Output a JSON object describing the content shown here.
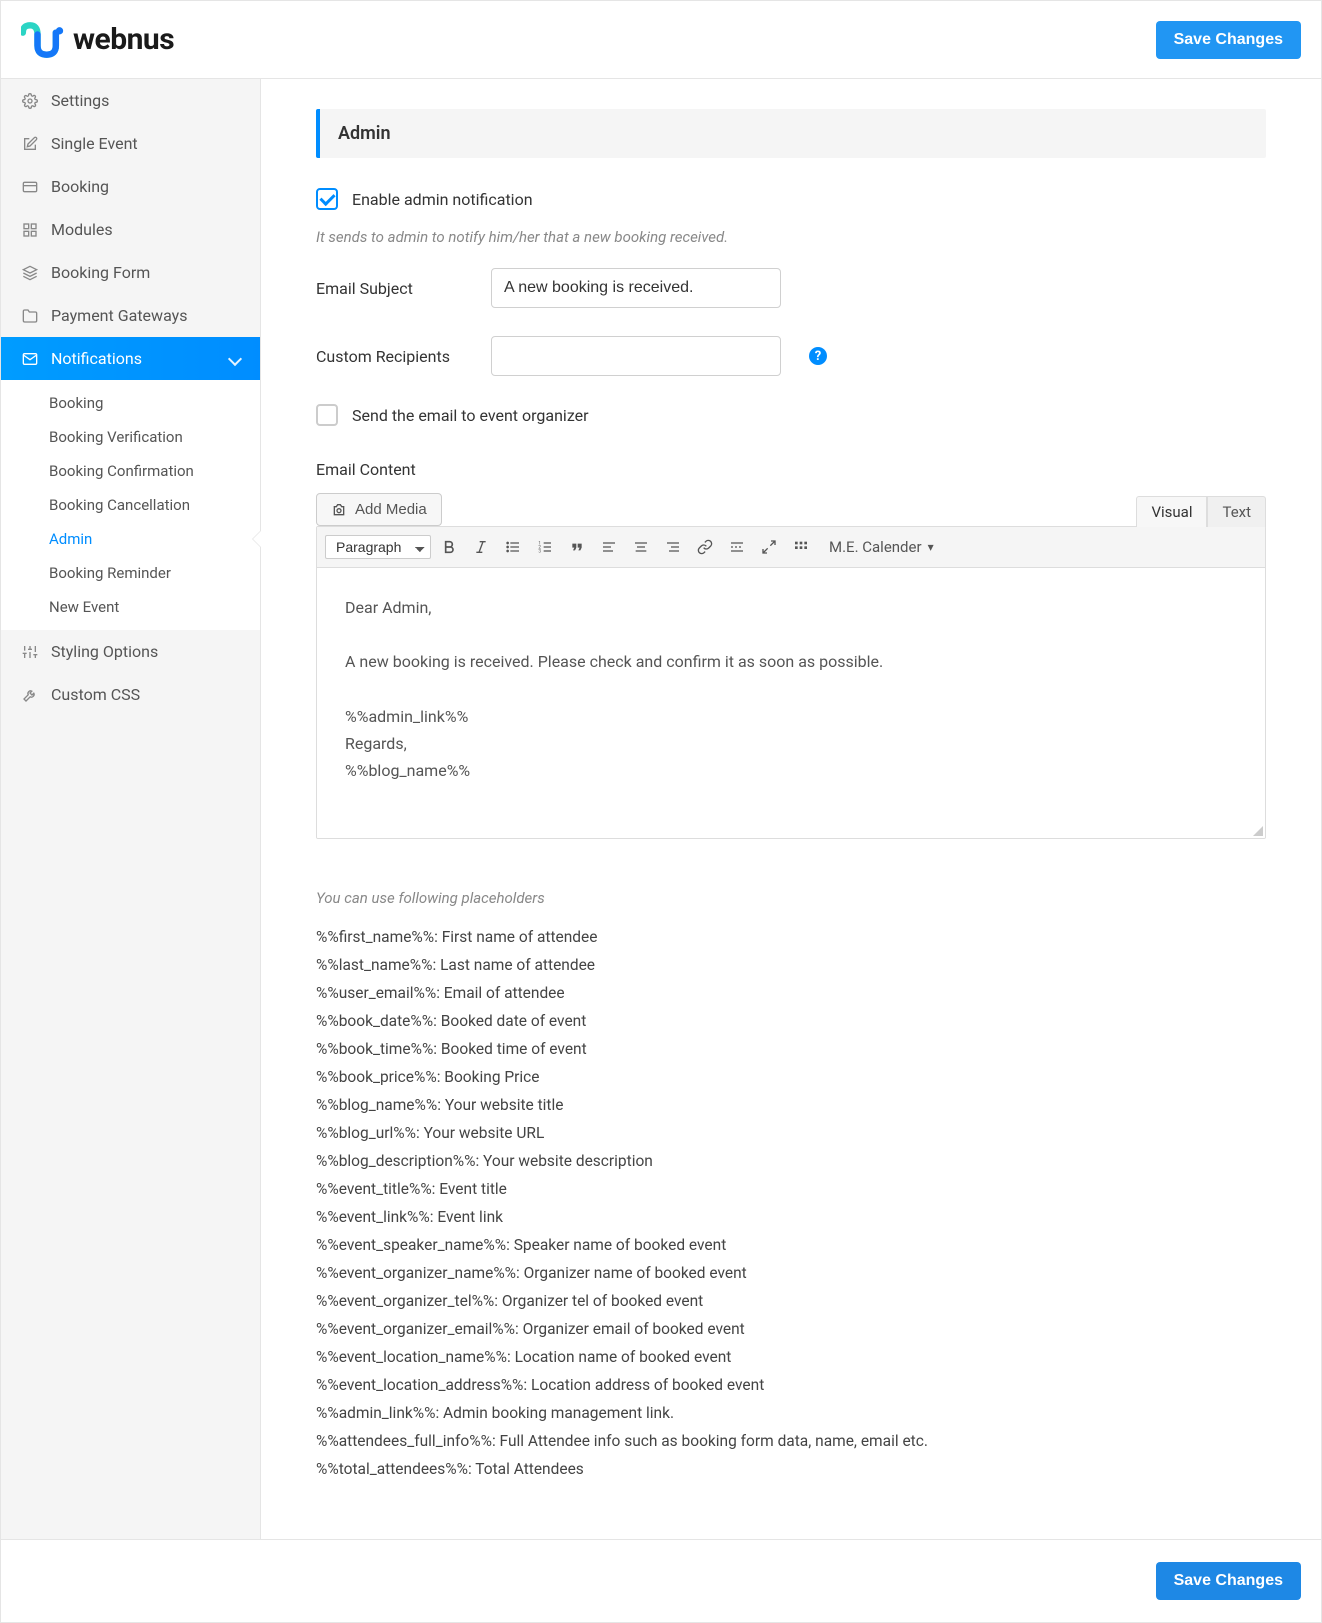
{
  "header": {
    "brand": "webnus",
    "save_label": "Save Changes"
  },
  "sidebar": {
    "items": [
      {
        "label": "Settings"
      },
      {
        "label": "Single Event"
      },
      {
        "label": "Booking"
      },
      {
        "label": "Modules"
      },
      {
        "label": "Booking Form"
      },
      {
        "label": "Payment Gateways"
      },
      {
        "label": "Notifications",
        "active": true
      },
      {
        "label": "Styling Options"
      },
      {
        "label": "Custom CSS"
      }
    ],
    "sub_items": [
      {
        "label": "Booking"
      },
      {
        "label": "Booking Verification"
      },
      {
        "label": "Booking Confirmation"
      },
      {
        "label": "Booking Cancellation"
      },
      {
        "label": "Admin",
        "active": true
      },
      {
        "label": "Booking Reminder"
      },
      {
        "label": "New Event"
      }
    ]
  },
  "panel": {
    "title": "Admin",
    "enable_label": "Enable admin notification",
    "enable_hint": "It sends to admin to notify him/her that a new booking received.",
    "subject_label": "Email Subject",
    "subject_value": "A new booking is received.",
    "recipients_label": "Custom Recipients",
    "recipients_value": "",
    "organizer_label": "Send the email to event organizer",
    "content_label": "Email Content",
    "add_media_label": "Add Media",
    "tabs": {
      "visual": "Visual",
      "text": "Text"
    },
    "paragraph_label": "Paragraph",
    "calendar_label": "M.E. Calender",
    "editor_body": "Dear Admin,\n\nA new booking is received. Please check and confirm it as soon as possible.\n\n%%admin_link%%\nRegards,\n%%blog_name%%",
    "ph_intro": "You can use following placeholders",
    "placeholders": [
      "%%first_name%%: First name of attendee",
      "%%last_name%%: Last name of attendee",
      "%%user_email%%: Email of attendee",
      "%%book_date%%: Booked date of event",
      "%%book_time%%: Booked time of event",
      "%%book_price%%: Booking Price",
      "%%blog_name%%: Your website title",
      "%%blog_url%%: Your website URL",
      "%%blog_description%%: Your website description",
      "%%event_title%%: Event title",
      "%%event_link%%: Event link",
      "%%event_speaker_name%%: Speaker name of booked event",
      "%%event_organizer_name%%: Organizer name of booked event",
      "%%event_organizer_tel%%: Organizer tel of booked event",
      "%%event_organizer_email%%: Organizer email of booked event",
      "%%event_location_name%%: Location name of booked event",
      "%%event_location_address%%: Location address of booked event",
      "%%admin_link%%: Admin booking management link.",
      "%%attendees_full_info%%: Full Attendee info such as booking form data, name, email etc.",
      "%%total_attendees%%: Total Attendees"
    ],
    "footer_save_label": "Save Changes"
  }
}
